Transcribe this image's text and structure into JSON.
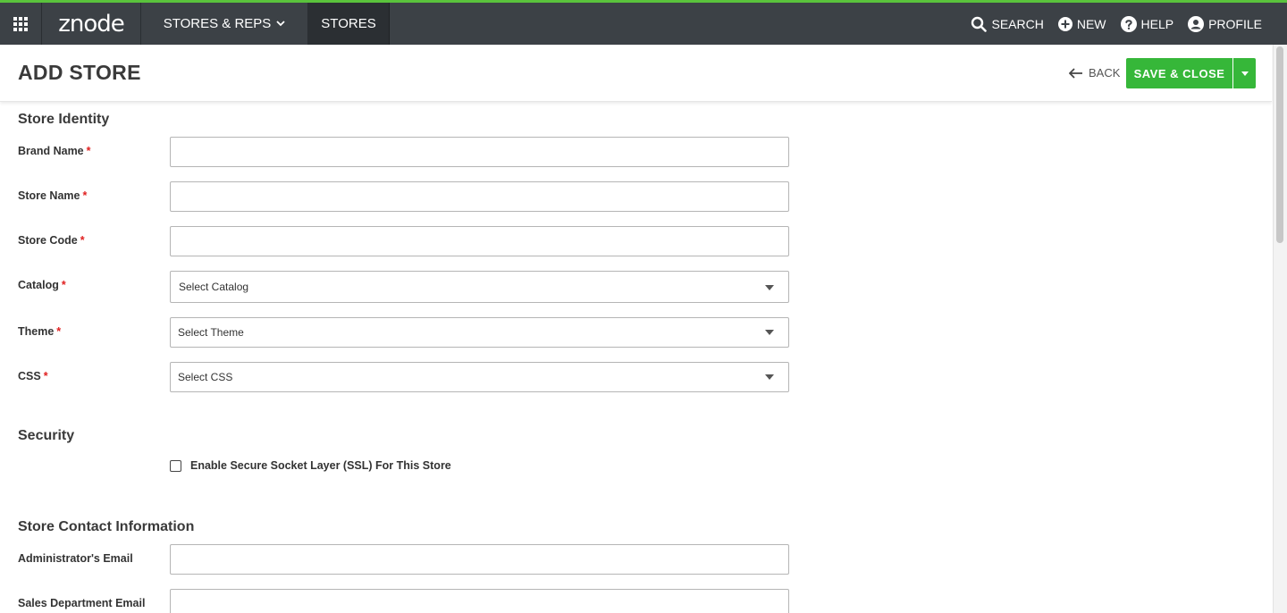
{
  "topbar": {
    "logo": "znode",
    "nav_stores_reps": "STORES & REPS",
    "nav_stores": "STORES",
    "search": "SEARCH",
    "new": "NEW",
    "help": "HELP",
    "profile": "PROFILE",
    "accent_color": "#5ac33c",
    "bg_color": "#3c4146"
  },
  "page": {
    "title": "ADD STORE",
    "back": "BACK",
    "save_close": "SAVE & CLOSE",
    "primary_color": "#36b739"
  },
  "sections": {
    "identity": "Store Identity",
    "security": "Security",
    "contact": "Store Contact Information"
  },
  "fields": {
    "brand_name": "Brand Name",
    "store_name": "Store Name",
    "store_code": "Store Code",
    "catalog": "Catalog",
    "theme": "Theme",
    "css": "CSS",
    "admin_email": "Administrator's Email",
    "sales_email": "Sales Department Email",
    "required_mark": "*"
  },
  "selects": {
    "catalog": "Select Catalog",
    "theme": "Select Theme",
    "css": "Select CSS"
  },
  "security": {
    "ssl_label": "Enable Secure Socket Layer (SSL) For This Store",
    "ssl_checked": false
  }
}
